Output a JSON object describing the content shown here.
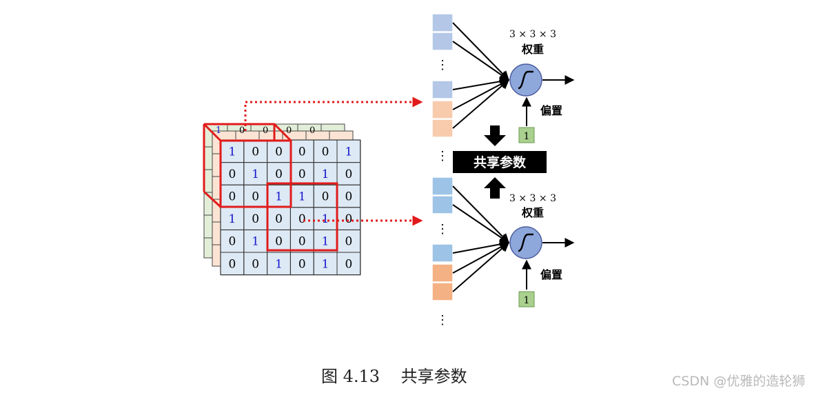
{
  "matrix": [
    [
      1,
      0,
      0,
      0,
      0,
      1
    ],
    [
      0,
      1,
      0,
      0,
      1,
      0
    ],
    [
      0,
      0,
      1,
      1,
      0,
      0
    ],
    [
      1,
      0,
      0,
      0,
      1,
      0
    ],
    [
      0,
      1,
      0,
      0,
      1,
      0
    ],
    [
      0,
      0,
      1,
      0,
      1,
      0
    ]
  ],
  "back_glimpse": [
    "1",
    "0",
    "0",
    "0",
    "0"
  ],
  "neuron_top": {
    "weights_label": "3 × 3 × 3",
    "weights_caption": "权重",
    "bias_caption": "偏置",
    "bias_value": "1"
  },
  "neuron_bottom": {
    "weights_label": "3 × 3 × 3",
    "weights_caption": "权重",
    "bias_caption": "偏置",
    "bias_value": "1"
  },
  "shared_label": "共享参数",
  "caption": "图 4.13    共享参数",
  "watermark": "CSDN @优雅的造轮狮",
  "colors": {
    "grid_front": "#dde9f4",
    "grid_mid": "#fbe4d4",
    "grid_back": "#e3eed9",
    "one_digit": "#1515cc",
    "highlight": "#e11b1b",
    "input_blue_light": "#b4c7e7",
    "input_blue": "#9dc3e6",
    "input_peach": "#f8cbad",
    "input_orange": "#f4b183",
    "neuron_fill": "#8fa8dc",
    "bias_box": "#a9d08e"
  }
}
